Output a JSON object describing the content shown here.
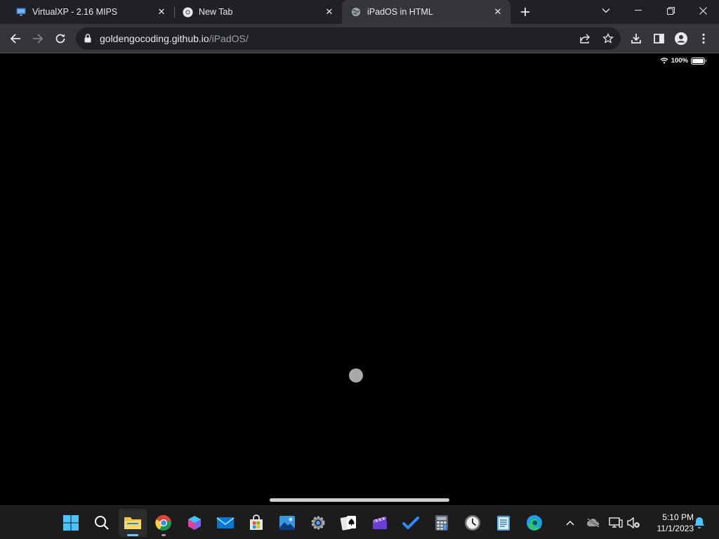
{
  "browser": {
    "tabs": [
      {
        "title": "VirtualXP - 2.16 MIPS",
        "icon": "virtualxp-icon"
      },
      {
        "title": "New Tab",
        "icon": "chrome-icon"
      },
      {
        "title": "iPadOS in HTML",
        "icon": "globe-icon",
        "active": true
      }
    ],
    "address": {
      "host": "goldengocoding.github.io",
      "path": "/iPadOS/"
    }
  },
  "ipad": {
    "status": {
      "battery_percent": "100%"
    },
    "loading": true
  },
  "taskbar": {
    "apps": [
      "start-icon",
      "search-icon",
      "file-explorer-icon",
      "chrome-icon",
      "copilot-icon",
      "mail-icon",
      "store-icon",
      "photos-icon",
      "settings-icon",
      "solitaire-icon",
      "clipchamp-icon",
      "todo-icon",
      "calculator-icon",
      "clock-icon",
      "notepad-icon",
      "edge-icon"
    ],
    "clock": {
      "time": "5:10 PM",
      "date": "11/1/2023"
    }
  },
  "colors": {
    "tab_strip": "#202124",
    "toolbar": "#35363a",
    "page_bg": "#000000",
    "accent": "#60cdff"
  }
}
